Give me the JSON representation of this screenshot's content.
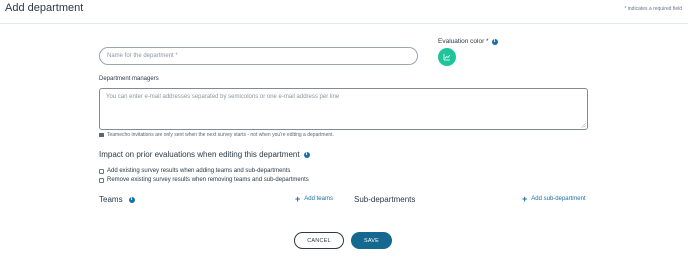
{
  "header": {
    "title": "Add department",
    "required_note": "* indicates a required field"
  },
  "form": {
    "name_placeholder": "Name for the department *",
    "evaluation_color_label": "Evaluation color *",
    "evaluation_color_value": "#1fc59a",
    "managers_label": "Department managers",
    "managers_placeholder": "You can enter e-mail addresses separated by semicolons or one e-mail address per line",
    "invitation_hint": "Teamecho invitations are only sent when the next survey starts - not when you're editing a department."
  },
  "impact": {
    "title": "Impact on prior evaluations when editing this department",
    "options": [
      {
        "label": "Add existing survey results when adding teams and sub-departments",
        "checked": false
      },
      {
        "label": "Remove existing survey results when removing teams and sub-departments",
        "checked": false
      }
    ]
  },
  "teams": {
    "title": "Teams",
    "add_label": "Add teams"
  },
  "subdepartments": {
    "title": "Sub-departments",
    "add_label": "Add sub-department"
  },
  "actions": {
    "cancel_label": "CANCEL",
    "save_label": "SAVE"
  },
  "colors": {
    "accent": "#1a6fa6",
    "save_button": "#15688f",
    "evaluation_color": "#1fc59a"
  },
  "icons": [
    "info-icon",
    "chart-icon",
    "envelope-icon",
    "plus-icon"
  ]
}
